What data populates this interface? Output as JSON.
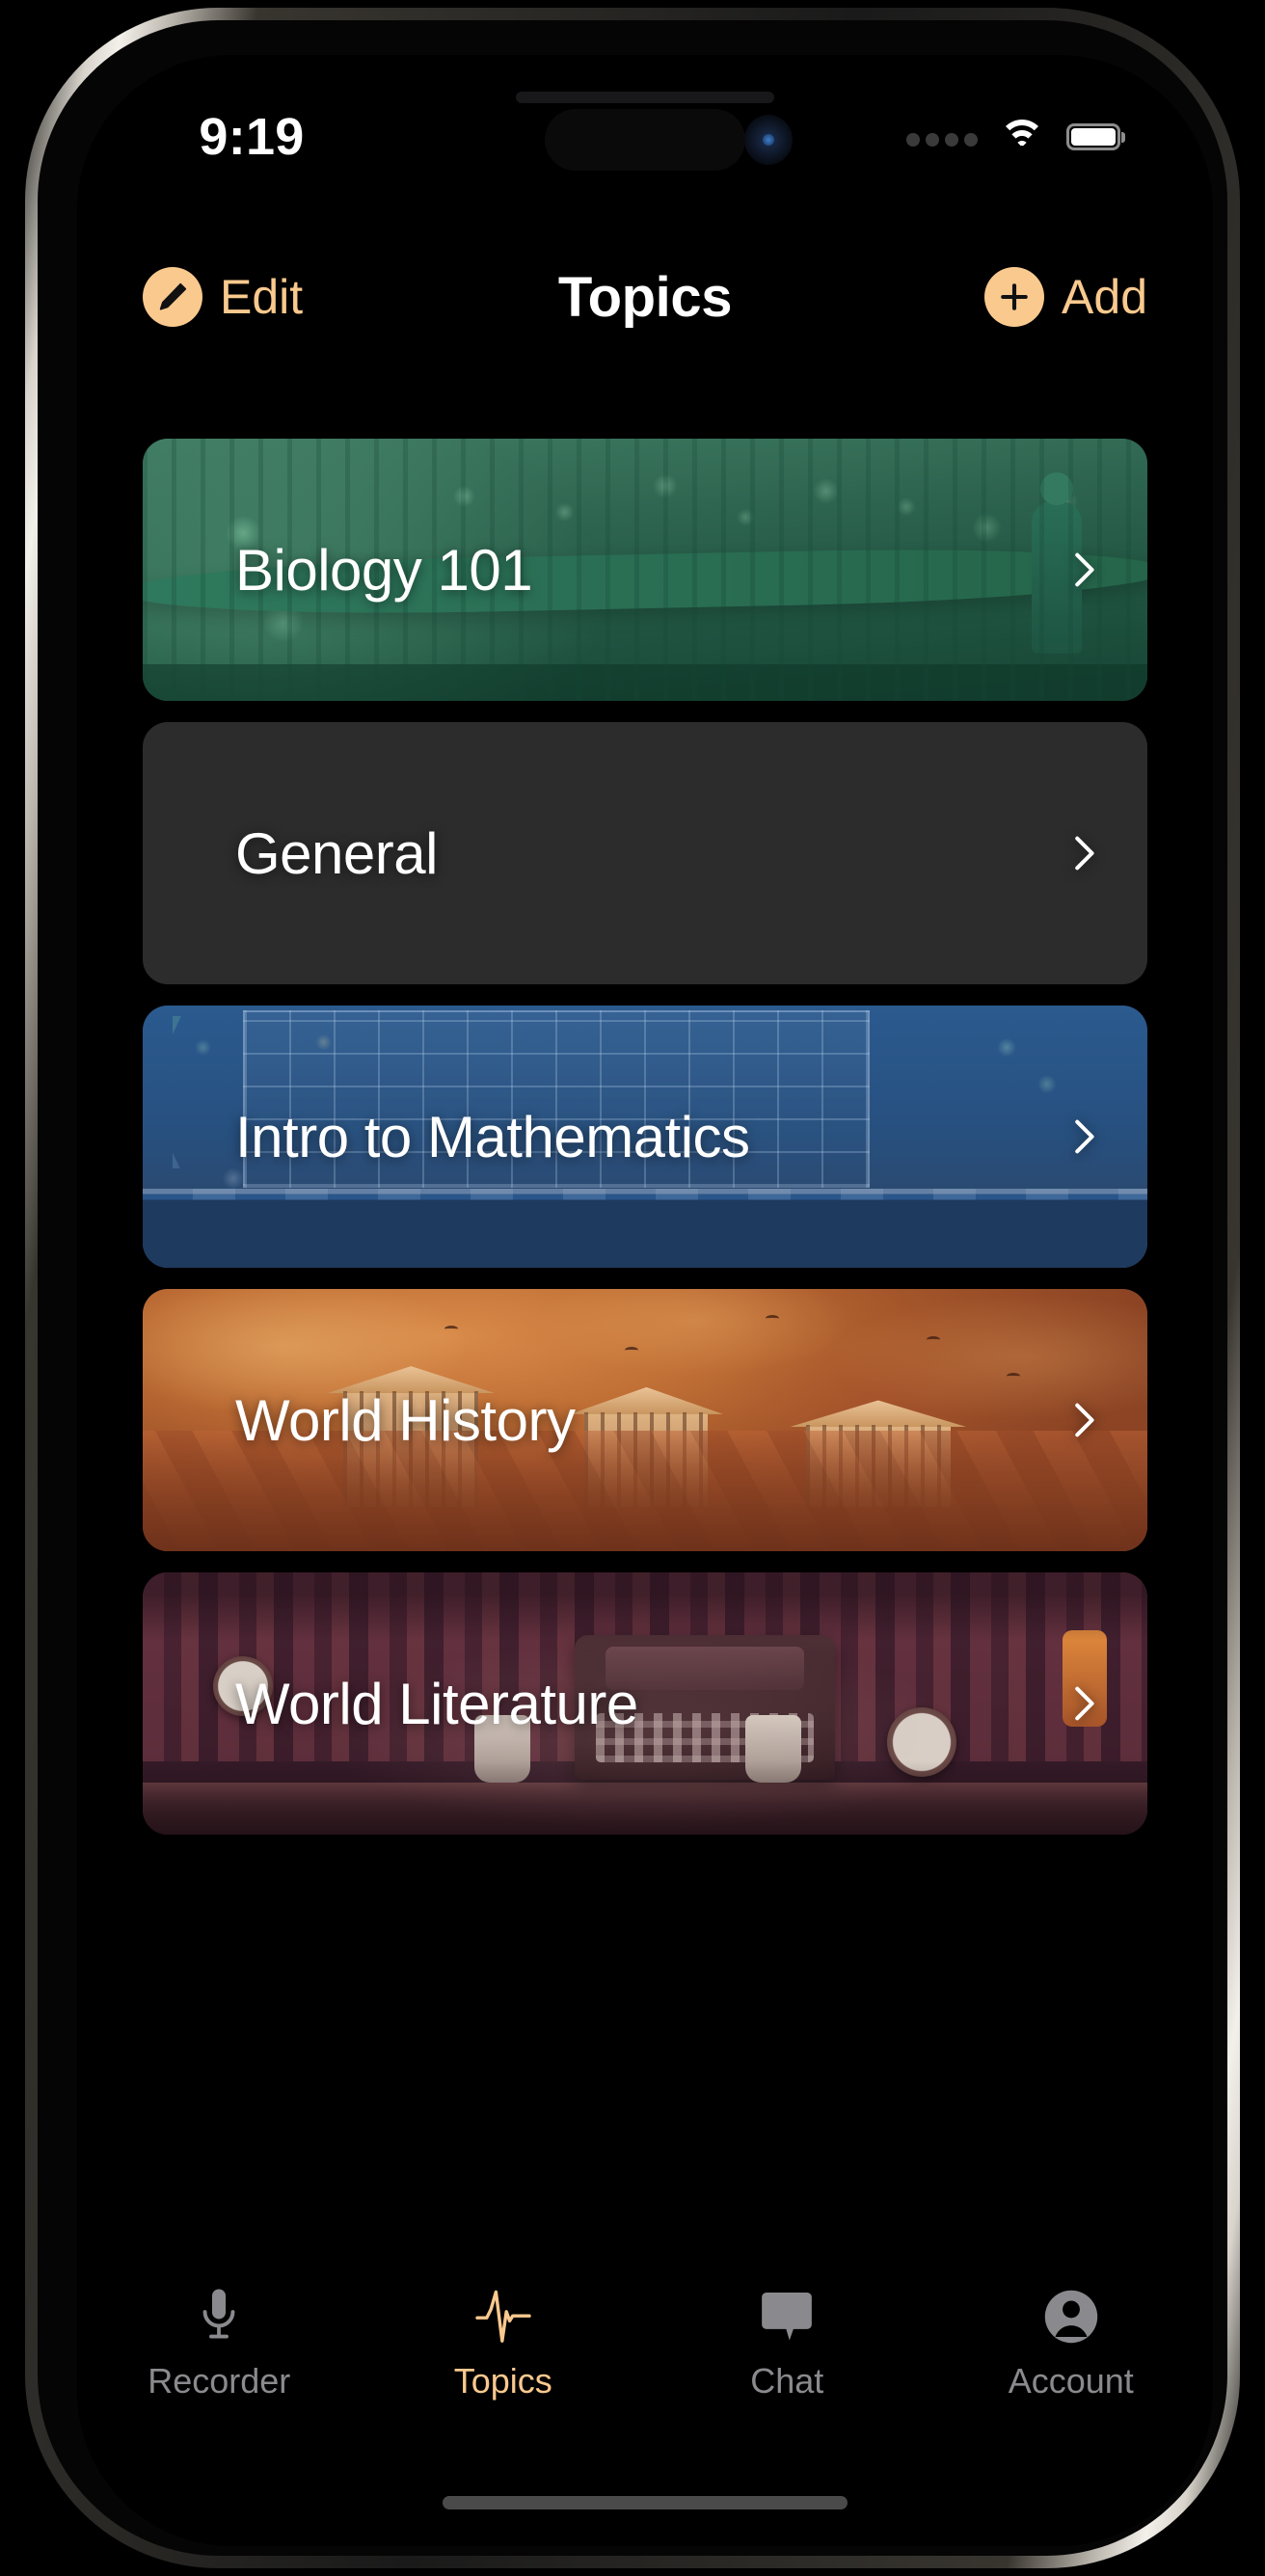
{
  "status_bar": {
    "time": "9:19",
    "cellular_icon": "cellular-dots-icon",
    "wifi_icon": "wifi-icon",
    "battery_icon": "battery-full-icon"
  },
  "nav_bar": {
    "title": "Topics",
    "edit_label": "Edit",
    "edit_icon": "pencil-circle-icon",
    "add_label": "Add",
    "add_icon": "plus-circle-icon"
  },
  "topics": [
    {
      "title": "Biology 101",
      "art": "biology",
      "chevron_icon": "chevron-right-icon"
    },
    {
      "title": "General",
      "art": "none",
      "chevron_icon": "chevron-right-icon"
    },
    {
      "title": "Intro to Mathematics",
      "art": "math",
      "chevron_icon": "chevron-right-icon"
    },
    {
      "title": "World History",
      "art": "history",
      "chevron_icon": "chevron-right-icon"
    },
    {
      "title": "World Literature",
      "art": "literature",
      "chevron_icon": "chevron-right-icon"
    }
  ],
  "tab_bar": {
    "items": [
      {
        "label": "Recorder",
        "icon": "microphone-icon",
        "active": false
      },
      {
        "label": "Topics",
        "icon": "waveform-pulse-icon",
        "active": true
      },
      {
        "label": "Chat",
        "icon": "speech-bubble-icon",
        "active": false
      },
      {
        "label": "Account",
        "icon": "person-circle-icon",
        "active": false
      }
    ]
  },
  "colors": {
    "accent": "#FAC98E",
    "background": "#000000",
    "card_plain": "#2C2C2C",
    "tab_inactive": "#8A8A8E",
    "text_primary": "#FFFFFF"
  }
}
